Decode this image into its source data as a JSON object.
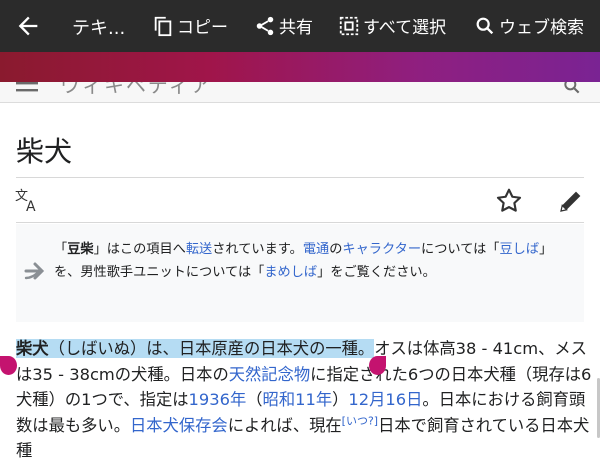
{
  "actionbar": {
    "title": "テキ...",
    "copy_label": "コピー",
    "share_label": "共有",
    "select_all_label": "すべて選択",
    "web_search_label": "ウェブ検索"
  },
  "header": {
    "logo_text": "ウィキペディア"
  },
  "article": {
    "title": "柴犬"
  },
  "hatnote": {
    "p1": "「",
    "term1": "豆柴",
    "p2": "」はこの項目へ",
    "redirect": "転送",
    "p3": "されています。",
    "l1": "電通",
    "p4": "の",
    "l2": "キャラクター",
    "p5": "については「",
    "l3": "豆しば",
    "p6": "」を、男性歌手ユニットについては「",
    "l4": "まめしば",
    "p7": "」をご覧ください。"
  },
  "paragraph": {
    "bold_term": "柴犬",
    "sel_rest": "（しばいぬ）は、日本原産の日本犬の一種。",
    "t1": "オスは体高38 - 41cm、メスは35 - 38cmの犬種。日本の",
    "l_monument": "天然記念物",
    "t2": "に指定された6つの日本犬種（現存は6犬種）の1つで、指定は",
    "l_year": "1936年",
    "t3": "（",
    "l_showa": "昭和11年",
    "t4": "）",
    "l_date": "12月16日",
    "t5": "。日本における飼育頭数は最も多い。",
    "l_society": "日本犬保存会",
    "t6": "によれば、現在",
    "sup": "[いつ?]",
    "t7": "日本で飼育されている日本犬種"
  },
  "colors": {
    "actionbar": "#2b2b2b",
    "selection": "#b5dcf3",
    "handle": "#c4136f",
    "link": "#3366cc"
  }
}
